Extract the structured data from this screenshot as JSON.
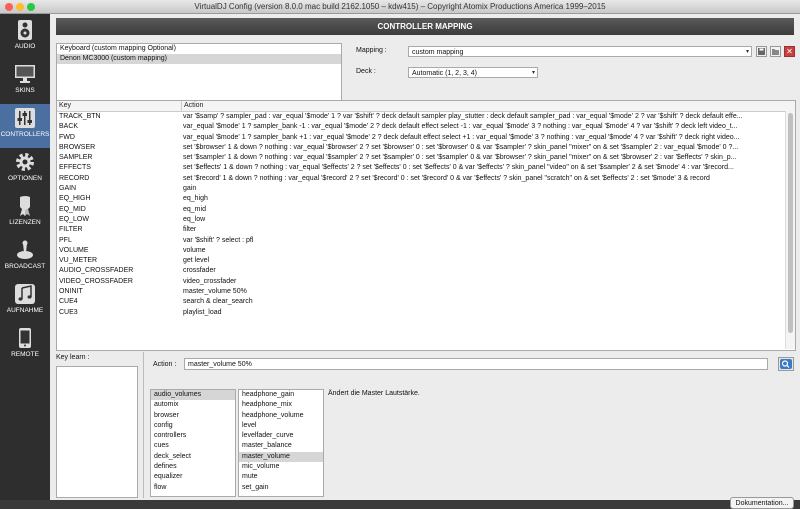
{
  "window": {
    "title": "VirtualDJ Config (version 8.0.0 mac build 2162.1050 – kdw415) – Copyright Atomix Productions America 1999–2015"
  },
  "sidebar": {
    "items": [
      {
        "label": "AUDIO",
        "icon": "speaker-icon"
      },
      {
        "label": "SKINS",
        "icon": "monitor-icon"
      },
      {
        "label": "CONTROLLERS",
        "icon": "mixer-sliders-icon",
        "active": true
      },
      {
        "label": "OPTIONEN",
        "icon": "gear-icon"
      },
      {
        "label": "LIZENZEN",
        "icon": "license-icon"
      },
      {
        "label": "BROADCAST",
        "icon": "broadcast-icon"
      },
      {
        "label": "AUFNAHME",
        "icon": "music-note-icon"
      },
      {
        "label": "REMOTE",
        "icon": "phone-icon"
      }
    ]
  },
  "header": {
    "title": "CONTROLLER MAPPING"
  },
  "devices": [
    {
      "label": "Keyboard (custom mapping Optional)",
      "selected": false
    },
    {
      "label": "Denon MC3000 (custom mapping)",
      "selected": true
    }
  ],
  "mapping": {
    "label": "Mapping :",
    "value": "custom mapping"
  },
  "deck": {
    "label": "Deck :",
    "value": "Automatic (1, 2, 3, 4)"
  },
  "table": {
    "headers": {
      "key": "Key",
      "action": "Action"
    },
    "rows": [
      {
        "key": "TRACK_BTN",
        "action": "var '$samp' ? sampler_pad : var_equal '$mode' 1 ? var '$shift' ? deck default sampler play_stutter : deck default sampler_pad : var_equal '$mode' 2 ? var '$shift' ? deck default effe..."
      },
      {
        "key": "BACK",
        "action": "var_equal '$mode' 1 ? sampler_bank -1 : var_equal '$mode' 2 ? deck default effect select -1 : var_equal '$mode' 3 ? nothing : var_equal '$mode' 4 ? var '$shift' ? deck left video_t..."
      },
      {
        "key": "FWD",
        "action": "var_equal '$mode' 1 ? sampler_bank +1 : var_equal '$mode' 2 ? deck default effect select +1 : var_equal '$mode' 3 ? nothing : var_equal '$mode' 4 ? var '$shift' ? deck right video..."
      },
      {
        "key": "BROWSER",
        "action": "set '$browser' 1 & down ? nothing : var_equal '$browser' 2 ? set '$browser' 0 : set '$browser' 0 & var '$sampler' ? skin_panel \"mixer\" on & set '$sampler' 2 : var_equal '$mode' 0 ?..."
      },
      {
        "key": "SAMPLER",
        "action": "set '$sampler' 1 & down ? nothing : var_equal '$sampler' 2 ? set '$sampler' 0 : set '$sampler' 0 & var '$browser' ? skin_panel \"mixer\" on & set '$browser' 2 : var '$effects' ? skin_p..."
      },
      {
        "key": "EFFECTS",
        "action": "set '$effects' 1 & down ? nothing : var_equal '$effects' 2 ? set '$effects' 0 : set '$effects' 0 & var '$effects' ? skin_panel \"video\" on & set '$sampler' 2 & set '$mode' 4 : var '$record..."
      },
      {
        "key": "RECORD",
        "action": "set '$record' 1 & down ? nothing : var_equal '$record' 2 ? set '$record' 0 : set '$record' 0 & var '$effects' ? skin_panel \"scratch\" on & set '$effects' 2 : set '$mode' 3 & record"
      },
      {
        "key": "GAIN",
        "action": "gain"
      },
      {
        "key": "EQ_HIGH",
        "action": "eq_high"
      },
      {
        "key": "EQ_MID",
        "action": "eq_mid"
      },
      {
        "key": "EQ_LOW",
        "action": "eq_low"
      },
      {
        "key": "FILTER",
        "action": "filter"
      },
      {
        "key": "PFL",
        "action": "var '$shift' ? select : pfl"
      },
      {
        "key": "VOLUME",
        "action": "volume"
      },
      {
        "key": "VU_METER",
        "action": "get level"
      },
      {
        "key": "AUDIO_CROSSFADER",
        "action": "crossfader"
      },
      {
        "key": "VIDEO_CROSSFADER",
        "action": "video_crossfader"
      },
      {
        "key": "ONINIT",
        "action": "master_volume 50%"
      },
      {
        "key": "CUE4",
        "action": "search & clear_search"
      },
      {
        "key": "CUE3",
        "action": "playlist_load"
      }
    ]
  },
  "keylearn": {
    "label": "Key learn :"
  },
  "action": {
    "label": "Action :",
    "value": "master_volume 50%"
  },
  "categories": [
    "audio_volumes",
    "automix",
    "browser",
    "config",
    "controllers",
    "cues",
    "deck_select",
    "defines",
    "equalizer",
    "flow"
  ],
  "categories_selected": 0,
  "verbs": [
    "headphone_gain",
    "headphone_mix",
    "headphone_volume",
    "level",
    "levelfader_curve",
    "master_balance",
    "master_volume",
    "mic_volume",
    "mute",
    "set_gain"
  ],
  "verbs_selected": 6,
  "description": "Ändert die Master Lautstärke.",
  "documentation_button": "Dokumentation...",
  "colors": {
    "accent": "#4a6fa0",
    "header": "#444444",
    "sidebar": "#2e2e2e"
  }
}
